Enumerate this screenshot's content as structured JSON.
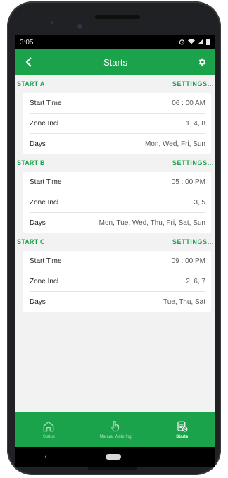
{
  "status_bar": {
    "time": "3:05"
  },
  "app_bar": {
    "title": "Starts"
  },
  "sections": [
    {
      "name": "START A",
      "settings_label": "SETTINGS...",
      "rows": [
        {
          "label": "Start Time",
          "value": "06 : 00 AM"
        },
        {
          "label": "Zone Incl",
          "value": "1, 4, 8"
        },
        {
          "label": "Days",
          "value": "Mon, Wed, Fri, Sun"
        }
      ]
    },
    {
      "name": "START B",
      "settings_label": "SETTINGS...",
      "rows": [
        {
          "label": "Start Time",
          "value": "05 : 00 PM"
        },
        {
          "label": "Zone Incl",
          "value": "3, 5"
        },
        {
          "label": "Days",
          "value": "Mon, Tue, Wed, Thu, Fri, Sat, Sun"
        }
      ]
    },
    {
      "name": "START C",
      "settings_label": "SETTINGS...",
      "rows": [
        {
          "label": "Start Time",
          "value": "09 : 00 PM"
        },
        {
          "label": "Zone Incl",
          "value": "2, 6, 7"
        },
        {
          "label": "Days",
          "value": "Tue, Thu, Sat"
        }
      ]
    }
  ],
  "bottom_nav": {
    "items": [
      {
        "label": "Status",
        "icon": "home-icon"
      },
      {
        "label": "Manual Watering",
        "icon": "hand-tap-icon"
      },
      {
        "label": "Starts",
        "icon": "schedule-list-icon",
        "active": true
      }
    ]
  },
  "colors": {
    "primary": "#1aa34a",
    "background": "#f2f2f2",
    "card": "#ffffff"
  }
}
